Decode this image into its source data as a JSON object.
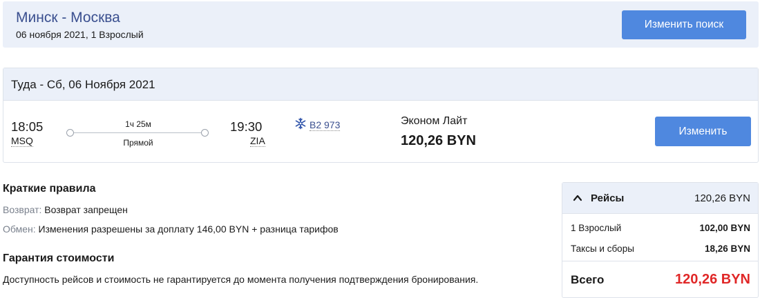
{
  "header": {
    "route": "Минск - Москва",
    "subtitle": "06 ноября 2021, 1 Взрослый",
    "change_search_label": "Изменить поиск"
  },
  "flight": {
    "direction_title": "Туда - Сб, 06 Ноября 2021",
    "departure_time": "18:05",
    "departure_airport": "MSQ",
    "duration": "1ч 25м",
    "stops": "Прямой",
    "arrival_time": "19:30",
    "arrival_airport": "ZIA",
    "flight_number": "B2 973",
    "airline_icon": "belavia-snowflake-icon",
    "fare_name": "Эконом Лайт",
    "fare_price": "120,26 BYN",
    "change_label": "Изменить"
  },
  "rules": {
    "title": "Краткие правила",
    "refund_label": "Возврат:",
    "refund_text": "Возврат запрещен",
    "exchange_label": "Обмен:",
    "exchange_text": "Изменения разрешены за доплату 146,00 BYN + разница тарифов"
  },
  "guarantee": {
    "title": "Гарантия стоимости",
    "text": "Доступность рейсов и стоимость не гарантируется до момента получения подтверждения бронирования."
  },
  "price_summary": {
    "flights_label": "Рейсы",
    "flights_total": "120,26 BYN",
    "rows": [
      {
        "label": "1 Взрослый",
        "value": "102,00 BYN"
      },
      {
        "label": "Таксы и сборы",
        "value": "18,26 BYN"
      }
    ],
    "total_label": "Всего",
    "total_value": "120,26 BYN"
  },
  "colors": {
    "accent": "#4f88df",
    "title_blue": "#3a4f8f",
    "panel_bg": "#ebf0f9",
    "total_red": "#e02727"
  }
}
